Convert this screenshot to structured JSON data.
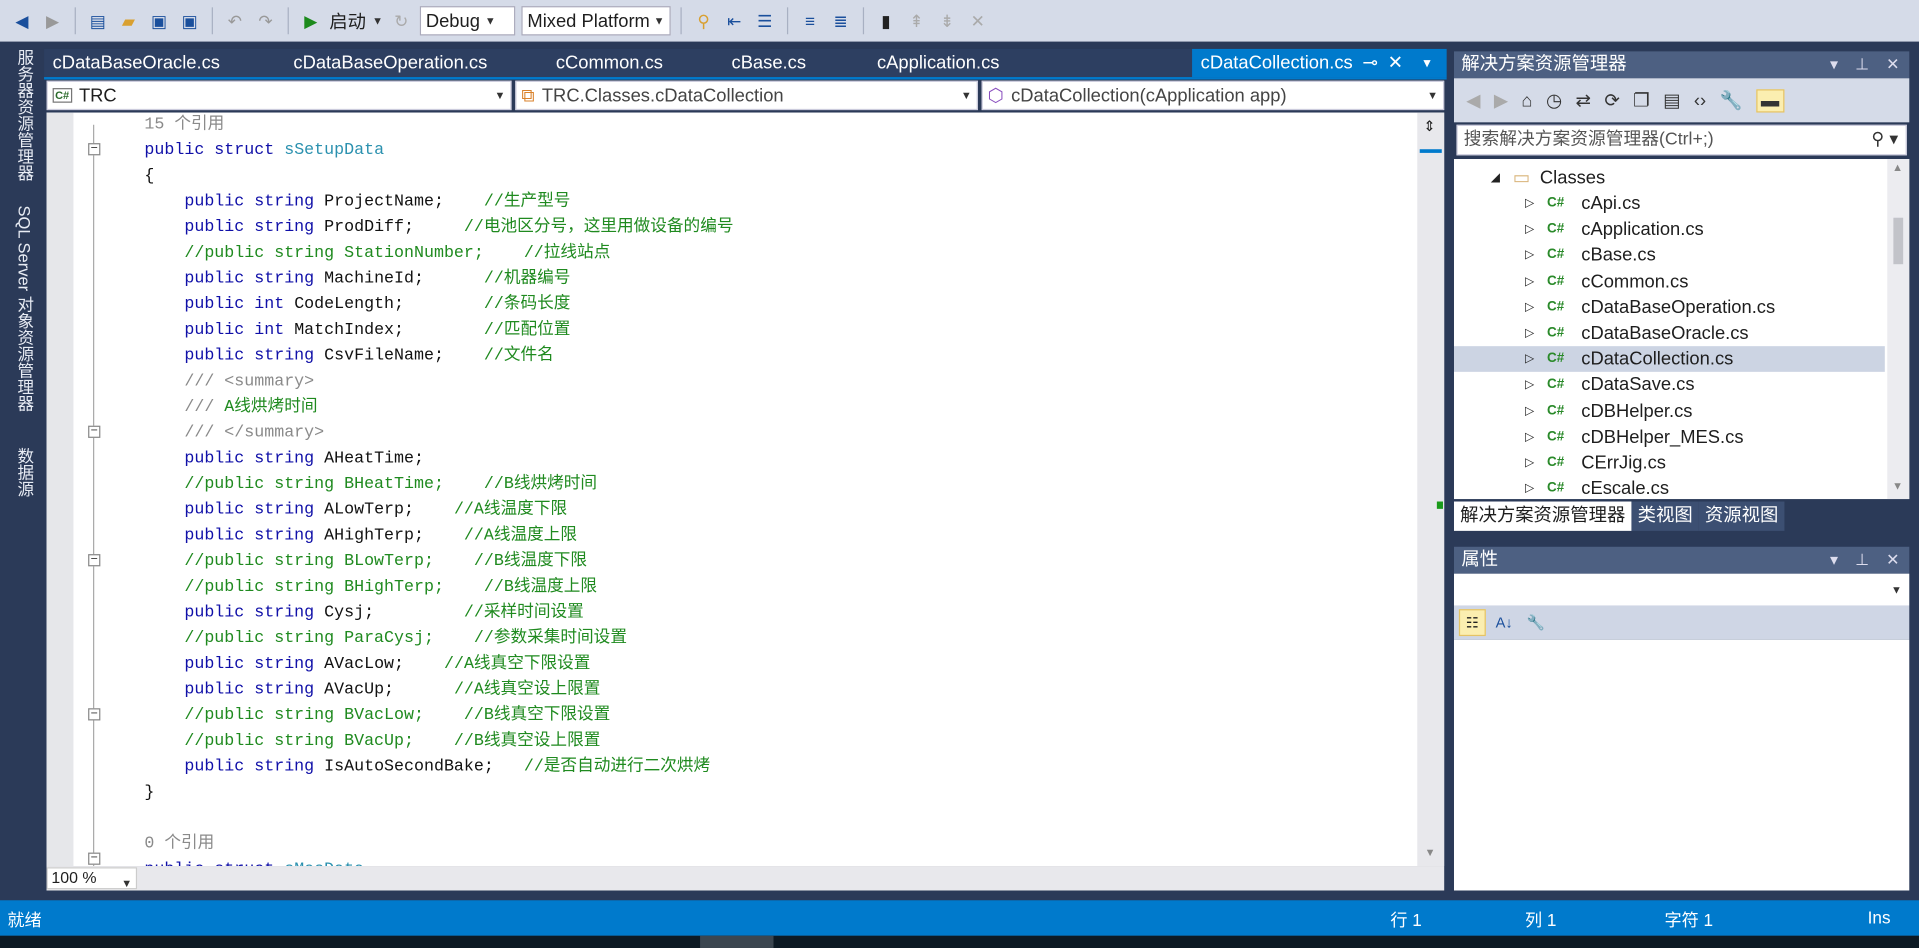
{
  "toolbar": {
    "start_label": "启动",
    "config": "Debug",
    "platform": "Mixed Platforms"
  },
  "left_tabs": [
    "服务器资源管理器",
    "SQL Server 对象资源管理器",
    "数据源"
  ],
  "doc_tabs": [
    "cDataBaseOracle.cs",
    "cDataBaseOperation.cs",
    "cCommon.cs",
    "cBase.cs",
    "cApplication.cs"
  ],
  "active_tab": "cDataCollection.cs",
  "navbar": {
    "project": "TRC",
    "type": "TRC.Classes.cDataCollection",
    "member": "cDataCollection(cApplication app)"
  },
  "code_lines": [
    [
      {
        "t": "15 个引用",
        "c": "gr"
      }
    ],
    [
      {
        "t": "public struct ",
        "c": "kw"
      },
      {
        "t": "sSetupData",
        "c": "ty"
      }
    ],
    [
      {
        "t": "{",
        "c": "id"
      }
    ],
    [
      {
        "t": "    public string ",
        "c": "kw"
      },
      {
        "t": "ProjectName;    ",
        "c": "id"
      },
      {
        "t": "//生产型号",
        "c": "cm"
      }
    ],
    [
      {
        "t": "    public string ",
        "c": "kw"
      },
      {
        "t": "ProdDiff;     ",
        "c": "id"
      },
      {
        "t": "//电池区分号，这里用做设备的编号",
        "c": "cm"
      }
    ],
    [
      {
        "t": "    //public string StationNumber;    //拉线站点",
        "c": "cm"
      }
    ],
    [
      {
        "t": "    public string ",
        "c": "kw"
      },
      {
        "t": "MachineId;      ",
        "c": "id"
      },
      {
        "t": "//机器编号",
        "c": "cm"
      }
    ],
    [
      {
        "t": "    public int ",
        "c": "kw"
      },
      {
        "t": "CodeLength;        ",
        "c": "id"
      },
      {
        "t": "//条码长度",
        "c": "cm"
      }
    ],
    [
      {
        "t": "    public int ",
        "c": "kw"
      },
      {
        "t": "MatchIndex;        ",
        "c": "id"
      },
      {
        "t": "//匹配位置",
        "c": "cm"
      }
    ],
    [
      {
        "t": "    public string ",
        "c": "kw"
      },
      {
        "t": "CsvFileName;    ",
        "c": "id"
      },
      {
        "t": "//文件名",
        "c": "cm"
      }
    ],
    [
      {
        "t": "    /// <summary>",
        "c": "gr"
      }
    ],
    [
      {
        "t": "    /// ",
        "c": "gr"
      },
      {
        "t": "A线烘烤时间",
        "c": "cm"
      }
    ],
    [
      {
        "t": "    /// </summary>",
        "c": "gr"
      }
    ],
    [
      {
        "t": "    public string ",
        "c": "kw"
      },
      {
        "t": "AHeatTime;",
        "c": "id"
      }
    ],
    [
      {
        "t": "    //public string BHeatTime;    //B线烘烤时间",
        "c": "cm"
      }
    ],
    [
      {
        "t": "    public string ",
        "c": "kw"
      },
      {
        "t": "ALowTerp;    ",
        "c": "id"
      },
      {
        "t": "//A线温度下限",
        "c": "cm"
      }
    ],
    [
      {
        "t": "    public string ",
        "c": "kw"
      },
      {
        "t": "AHighTerp;    ",
        "c": "id"
      },
      {
        "t": "//A线温度上限",
        "c": "cm"
      }
    ],
    [
      {
        "t": "    //public string BLowTerp;    //B线温度下限",
        "c": "cm"
      }
    ],
    [
      {
        "t": "    //public string BHighTerp;    //B线温度上限",
        "c": "cm"
      }
    ],
    [
      {
        "t": "    public string ",
        "c": "kw"
      },
      {
        "t": "Cysj;         ",
        "c": "id"
      },
      {
        "t": "//采样时间设置",
        "c": "cm"
      }
    ],
    [
      {
        "t": "    //public string ParaCysj;    //参数采集时间设置",
        "c": "cm"
      }
    ],
    [
      {
        "t": "    public string ",
        "c": "kw"
      },
      {
        "t": "AVacLow;    ",
        "c": "id"
      },
      {
        "t": "//A线真空下限设置",
        "c": "cm"
      }
    ],
    [
      {
        "t": "    public string ",
        "c": "kw"
      },
      {
        "t": "AVacUp;      ",
        "c": "id"
      },
      {
        "t": "//A线真空设上限置",
        "c": "cm"
      }
    ],
    [
      {
        "t": "    //public string BVacLow;    //B线真空下限设置",
        "c": "cm"
      }
    ],
    [
      {
        "t": "    //public string BVacUp;    //B线真空设上限置",
        "c": "cm"
      }
    ],
    [
      {
        "t": "    public string ",
        "c": "kw"
      },
      {
        "t": "IsAutoSecondBake;   ",
        "c": "id"
      },
      {
        "t": "//是否自动进行二次烘烤",
        "c": "cm"
      }
    ],
    [
      {
        "t": "}",
        "c": "id"
      }
    ],
    [
      {
        "t": "",
        "c": "id"
      }
    ],
    [
      {
        "t": "0 个引用",
        "c": "gr"
      }
    ],
    [
      {
        "t": "public struct ",
        "c": "kw"
      },
      {
        "t": "sMesData",
        "c": "ty"
      }
    ]
  ],
  "zoom": "100 %",
  "status": {
    "ready": "就绪",
    "line": "行 1",
    "col": "列 1",
    "char": "字符 1",
    "mode": "Ins"
  },
  "solution_explorer": {
    "title": "解决方案资源管理器",
    "search_placeholder": "搜索解决方案资源管理器(Ctrl+;)",
    "folder": "Classes",
    "files": [
      "cApi.cs",
      "cApplication.cs",
      "cBase.cs",
      "cCommon.cs",
      "cDataBaseOperation.cs",
      "cDataBaseOracle.cs",
      "cDataCollection.cs",
      "cDataSave.cs",
      "cDBHelper.cs",
      "cDBHelper_MES.cs",
      "CErrJig.cs",
      "cEscale.cs"
    ],
    "selected": "cDataCollection.cs",
    "file_icon": "C#"
  },
  "panel_tabs": [
    "解决方案资源管理器",
    "类视图",
    "资源视图"
  ],
  "properties": {
    "title": "属性"
  },
  "colors": {
    "accent": "#007acc",
    "keyword": "#1010a8",
    "comment": "#1f8a1f",
    "type": "#2b91af"
  }
}
